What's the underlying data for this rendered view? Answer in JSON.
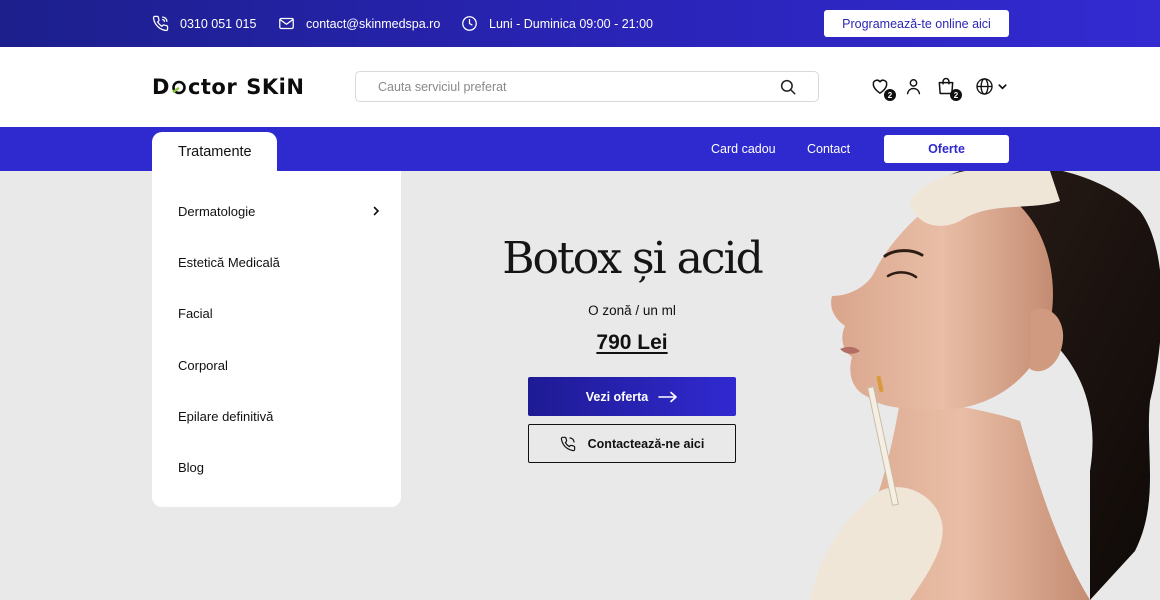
{
  "topbar": {
    "phone": "0310 051  015",
    "email": "contact@skinmedspa.ro",
    "hours": "Luni - Duminica 09:00 - 21:00",
    "cta_label": "Programează-te online aici"
  },
  "header": {
    "logo": {
      "part1": "D",
      "part2": "ctor",
      "part3": "SKiN"
    },
    "search_placeholder": "Cauta serviciul preferat",
    "wishlist_count": "2",
    "cart_count": "2"
  },
  "nav": {
    "active_tab": "Tratamente",
    "links": [
      "Card cadou",
      "Contact"
    ],
    "offers_label": "Oferte"
  },
  "menu": {
    "items": [
      "Dermatologie",
      "Estetică Medicală",
      "Facial",
      "Corporal",
      "Epilare definitivă",
      "Blog"
    ]
  },
  "hero": {
    "title": "Botox și acid",
    "subtitle": "O zonă / un ml",
    "price": "790 Lei",
    "primary_button": "Vezi oferta",
    "secondary_button": "Contactează-ne aici"
  },
  "colors": {
    "brand_blue": "#2e2ad0",
    "logo_accent": "#8bc53f",
    "hero_bg": "#e9e9e9"
  },
  "icons": [
    "phone-icon",
    "mail-icon",
    "clock-icon",
    "search-icon",
    "heart-icon",
    "user-icon",
    "bag-icon",
    "globe-icon",
    "chevron-down-icon",
    "chevron-right-icon",
    "arrow-right-icon"
  ]
}
